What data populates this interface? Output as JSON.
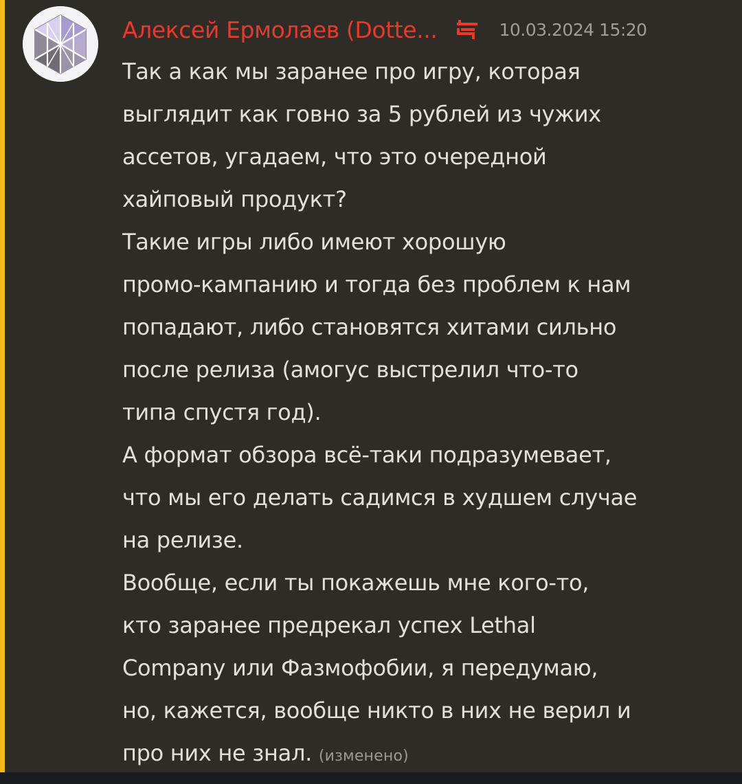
{
  "message": {
    "author": "Алексей Ермолаев (Dotte...",
    "timestamp": "10.03.2024 15:20",
    "role_icon": "server-role-icon",
    "avatar_icon": "geometric-avatar-icon",
    "accent_color": "#f5b814",
    "author_color": "#e8392b",
    "paragraphs": [
      "Так а как мы заранее про игру, которая\nвыглядит как говно за 5 рублей из чужих\nассетов, угадаем, что это очередной\nхайповый продукт?",
      "Такие игры либо имеют хорошую\nпромо-кампанию и тогда без проблем к нам\nпопадают, либо становятся хитами сильно\nпосле релиза (амогус выстрелил что-то\nтипа спустя год).",
      "А формат обзора всё-таки подразумевает,\nчто мы его делать садимся в худшем случае\nна релизе.",
      "Вообще, если ты покажешь мне кого-то,\nкто заранее предрекал успех Lethal\nCompany или Фазмофобии, я передумаю,\nно, кажется, вообще никто в них не верил и\nпро них не знал."
    ],
    "edited_label": "(изменено)"
  }
}
